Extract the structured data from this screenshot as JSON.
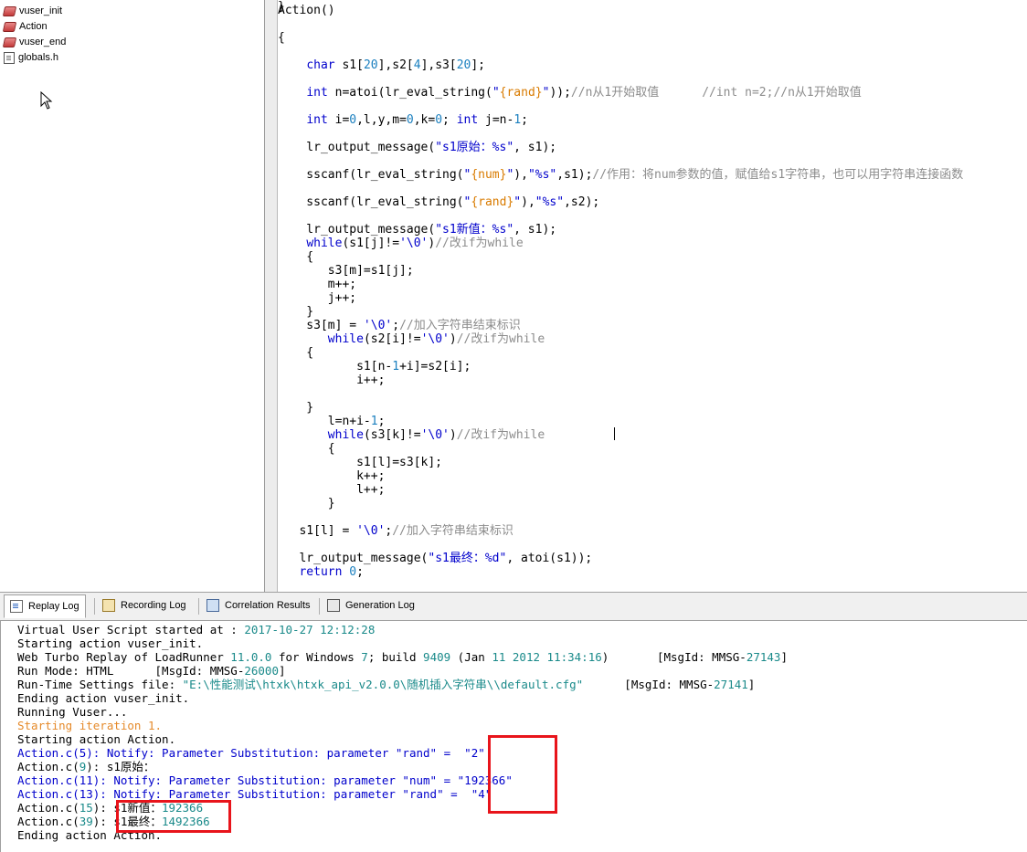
{
  "tree": {
    "items": [
      {
        "label": "vuser_init",
        "icon": "action-icon"
      },
      {
        "label": "Action",
        "icon": "action-icon"
      },
      {
        "label": "vuser_end",
        "icon": "action-icon"
      },
      {
        "label": "globals.h",
        "icon": "header-file-icon"
      }
    ]
  },
  "editor": {
    "lines": [
      {
        "parts": [
          [
            "Action()",
            ""
          ]
        ]
      },
      {
        "parts": [
          [
            "{",
            ""
          ]
        ]
      },
      {
        "parts": [
          [
            "    ",
            ""
          ],
          [
            "char",
            "kw"
          ],
          [
            " s1[",
            ""
          ],
          [
            "20",
            "num"
          ],
          [
            "],s2[",
            ""
          ],
          [
            "4",
            "num"
          ],
          [
            "],s3[",
            ""
          ],
          [
            "20",
            "num"
          ],
          [
            "];",
            ""
          ]
        ]
      },
      {
        "parts": [
          [
            "    ",
            ""
          ],
          [
            "int",
            "kw"
          ],
          [
            " n=atoi(lr_eval_string(",
            ""
          ],
          [
            "\"",
            "str"
          ],
          [
            "{rand}",
            "param"
          ],
          [
            "\"",
            "str"
          ],
          [
            "));",
            ""
          ],
          [
            "//n从1开始取值      //int n=2;//n从1开始取值",
            "cmt"
          ]
        ]
      },
      {
        "parts": [
          [
            "    ",
            ""
          ],
          [
            "int",
            "kw"
          ],
          [
            " i=",
            ""
          ],
          [
            "0",
            "num"
          ],
          [
            ",l,y,m=",
            ""
          ],
          [
            "0",
            "num"
          ],
          [
            ",k=",
            ""
          ],
          [
            "0",
            "num"
          ],
          [
            "; ",
            ""
          ],
          [
            "int",
            "kw"
          ],
          [
            " j=n-",
            ""
          ],
          [
            "1",
            "num"
          ],
          [
            ";",
            ""
          ]
        ]
      },
      {
        "parts": [
          [
            "    lr_output_message(",
            ""
          ],
          [
            "\"s1原始：%s\"",
            "str"
          ],
          [
            ", s1);",
            ""
          ]
        ]
      },
      {
        "parts": [
          [
            "    sscanf(lr_eval_string(",
            ""
          ],
          [
            "\"",
            "str"
          ],
          [
            "{num}",
            "param"
          ],
          [
            "\"",
            "str"
          ],
          [
            "),",
            ""
          ],
          [
            "\"%s\"",
            "str"
          ],
          [
            ",s1);",
            ""
          ],
          [
            "//作用：将num参数的值，赋值给s1字符串，也可以用字符串连接函数",
            "cmt"
          ]
        ]
      },
      {
        "parts": [
          [
            "    sscanf(lr_eval_string(",
            ""
          ],
          [
            "\"",
            "str"
          ],
          [
            "{rand}",
            "param"
          ],
          [
            "\"",
            "str"
          ],
          [
            "),",
            ""
          ],
          [
            "\"%s\"",
            "str"
          ],
          [
            ",s2);",
            ""
          ]
        ]
      },
      {
        "parts": [
          [
            "    lr_output_message(",
            ""
          ],
          [
            "\"s1新值：%s\"",
            "str"
          ],
          [
            ", s1);",
            ""
          ]
        ]
      },
      {
        "parts": [
          [
            "    ",
            ""
          ],
          [
            "while",
            "kw"
          ],
          [
            "(s1[j]!=",
            ""
          ],
          [
            "'\\0'",
            "str"
          ],
          [
            ")",
            ""
          ],
          [
            "//改if为while",
            "cmt"
          ]
        ]
      },
      {
        "parts": [
          [
            "    {",
            ""
          ]
        ]
      },
      {
        "parts": [
          [
            "       s3[m]=s1[j];",
            ""
          ]
        ]
      },
      {
        "parts": [
          [
            "       m++;",
            ""
          ]
        ]
      },
      {
        "parts": [
          [
            "       j++;",
            ""
          ]
        ]
      },
      {
        "parts": [
          [
            "    }",
            ""
          ]
        ]
      },
      {
        "parts": [
          [
            "    s3[m] = ",
            ""
          ],
          [
            "'\\0'",
            "str"
          ],
          [
            ";",
            ""
          ],
          [
            "//加入字符串结束标识",
            "cmt"
          ]
        ]
      },
      {
        "parts": [
          [
            "       ",
            ""
          ],
          [
            "while",
            "kw"
          ],
          [
            "(s2[i]!=",
            ""
          ],
          [
            "'\\0'",
            "str"
          ],
          [
            ")",
            ""
          ],
          [
            "//改if为while",
            "cmt"
          ]
        ]
      },
      {
        "parts": [
          [
            "    {",
            ""
          ]
        ]
      },
      {
        "parts": [
          [
            "           s1[n-",
            ""
          ],
          [
            "1",
            "num"
          ],
          [
            "+i]=s2[i];",
            ""
          ]
        ]
      },
      {
        "parts": [
          [
            "           i++;",
            ""
          ]
        ]
      },
      {
        "parts": [
          [
            "    }",
            ""
          ]
        ]
      },
      {
        "parts": [
          [
            "       l=n+i-",
            ""
          ],
          [
            "1",
            "num"
          ],
          [
            ";",
            ""
          ]
        ]
      },
      {
        "parts": [
          [
            "       ",
            ""
          ],
          [
            "while",
            "kw"
          ],
          [
            "(s3[k]!=",
            ""
          ],
          [
            "'\\0'",
            "str"
          ],
          [
            ")",
            ""
          ],
          [
            "//改if为while",
            "cmt"
          ]
        ]
      },
      {
        "parts": [
          [
            "       {",
            ""
          ]
        ]
      },
      {
        "parts": [
          [
            "           s1[l]=s3[k];",
            ""
          ]
        ]
      },
      {
        "parts": [
          [
            "           k++;",
            ""
          ]
        ]
      },
      {
        "parts": [
          [
            "           l++;",
            ""
          ]
        ]
      },
      {
        "parts": [
          [
            "       }",
            ""
          ]
        ]
      },
      {
        "parts": [
          [
            "   s1[l] = ",
            ""
          ],
          [
            "'\\0'",
            "str"
          ],
          [
            ";",
            ""
          ],
          [
            "//加入字符串结束标识",
            "cmt"
          ]
        ]
      },
      {
        "parts": [
          [
            "   lr_output_message(",
            ""
          ],
          [
            "\"s1最终：%d\"",
            "str"
          ],
          [
            ", atoi(s1));",
            ""
          ]
        ]
      },
      {
        "parts": [
          [
            "   ",
            ""
          ],
          [
            "return",
            "kw"
          ],
          [
            " ",
            ""
          ],
          [
            "0",
            "num"
          ],
          [
            ";",
            ""
          ]
        ]
      },
      {
        "parts": [
          [
            "}",
            ""
          ]
        ]
      }
    ]
  },
  "tabs": [
    {
      "label": "Replay Log",
      "icon": "replay-log-icon",
      "active": true
    },
    {
      "label": "Recording Log",
      "icon": "recording-log-icon",
      "active": false
    },
    {
      "label": "Correlation Results",
      "icon": "correlation-results-icon",
      "active": false
    },
    {
      "label": "Generation Log",
      "icon": "generation-log-icon",
      "active": false
    }
  ],
  "log": {
    "lines": [
      {
        "parts": [
          [
            "Virtual User Script started at : ",
            ""
          ],
          [
            "2017-10-27 12:12:28",
            "teal"
          ]
        ]
      },
      {
        "parts": [
          [
            "Starting action vuser_init.",
            ""
          ]
        ]
      },
      {
        "parts": [
          [
            "Web Turbo Replay of LoadRunner ",
            ""
          ],
          [
            "11.0.0",
            "teal"
          ],
          [
            " for Windows ",
            ""
          ],
          [
            "7",
            "teal"
          ],
          [
            "; build ",
            ""
          ],
          [
            "9409",
            "teal"
          ],
          [
            " (Jan ",
            ""
          ],
          [
            "11",
            "teal"
          ],
          [
            " ",
            ""
          ],
          [
            "2012",
            "teal"
          ],
          [
            " ",
            ""
          ],
          [
            "11:34:16",
            "teal"
          ],
          [
            ")       [MsgId: MMSG-",
            ""
          ],
          [
            "27143",
            "teal"
          ],
          [
            "]",
            ""
          ]
        ]
      },
      {
        "parts": [
          [
            "Run Mode: HTML      [MsgId: MMSG-",
            ""
          ],
          [
            "26000",
            "teal"
          ],
          [
            "]",
            ""
          ]
        ]
      },
      {
        "parts": [
          [
            "Run-Time Settings file: ",
            ""
          ],
          [
            "\"E:\\性能测试\\htxk\\htxk_api_v2.0.0\\随机插入字符串\\\\default.cfg\"",
            "teal"
          ],
          [
            "      [MsgId: MMSG-",
            ""
          ],
          [
            "27141",
            "teal"
          ],
          [
            "]",
            ""
          ]
        ]
      },
      {
        "parts": [
          [
            "Ending action vuser_init.",
            ""
          ]
        ]
      },
      {
        "parts": [
          [
            "Running Vuser...",
            ""
          ]
        ]
      },
      {
        "parts": [
          [
            "Starting iteration 1.",
            "orange"
          ]
        ]
      },
      {
        "parts": [
          [
            "Starting action Action.",
            ""
          ]
        ]
      },
      {
        "parts": [
          [
            "Action.c(5): Notify: Parameter Substitution: parameter \"rand\" =  \"2\"",
            "blue"
          ]
        ]
      },
      {
        "parts": [
          [
            "Action.c(",
            ""
          ],
          [
            "9",
            "teal"
          ],
          [
            "): s1原始：",
            ""
          ]
        ]
      },
      {
        "parts": [
          [
            "Action.c(11): Notify: Parameter Substitution: parameter \"num\" = \"192366\"",
            "blue"
          ]
        ]
      },
      {
        "parts": [
          [
            "Action.c(13): Notify: Parameter Substitution: parameter \"rand\" =  \"4\"",
            "blue"
          ]
        ]
      },
      {
        "parts": [
          [
            "Action.c(",
            ""
          ],
          [
            "15",
            "teal"
          ],
          [
            "): s1新值：",
            ""
          ],
          [
            "192366",
            "teal"
          ]
        ]
      },
      {
        "parts": [
          [
            "Action.c(",
            ""
          ],
          [
            "39",
            "teal"
          ],
          [
            "): s1最终：",
            ""
          ],
          [
            "1492366",
            "teal"
          ]
        ]
      },
      {
        "parts": [
          [
            "Ending action Action.",
            ""
          ]
        ]
      }
    ]
  },
  "colors": {
    "highlight_box": "#e8141b",
    "keyword": "#0000cc",
    "parameter": "#d97b00",
    "comment": "#8c8c8c",
    "number": "#1a8a8a"
  }
}
